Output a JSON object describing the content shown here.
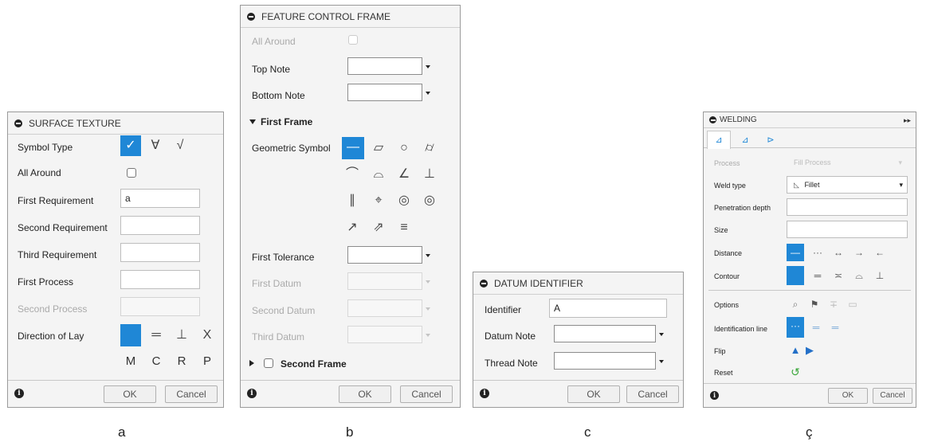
{
  "surface": {
    "title": "SURFACE TEXTURE",
    "symbol_type": "Symbol Type",
    "all_around": "All Around",
    "first_req": "First Requirement",
    "first_req_value": "a",
    "second_req": "Second Requirement",
    "third_req": "Third Requirement",
    "first_process": "First Process",
    "second_process": "Second Process",
    "direction_of_lay": "Direction of Lay",
    "lay_letters": [
      "M",
      "C",
      "R",
      "P"
    ],
    "ok": "OK",
    "cancel": "Cancel"
  },
  "fcf": {
    "title": "FEATURE CONTROL FRAME",
    "all_around": "All Around",
    "top_note": "Top Note",
    "bottom_note": "Bottom Note",
    "first_frame": "First Frame",
    "geometric_symbol": "Geometric Symbol",
    "first_tolerance": "First Tolerance",
    "first_datum": "First Datum",
    "second_datum": "Second Datum",
    "third_datum": "Third Datum",
    "second_frame": "Second Frame",
    "ok": "OK",
    "cancel": "Cancel"
  },
  "datum": {
    "title": "DATUM IDENTIFIER",
    "identifier": "Identifier",
    "identifier_value": "A",
    "datum_note": "Datum Note",
    "thread_note": "Thread Note",
    "ok": "OK",
    "cancel": "Cancel"
  },
  "welding": {
    "title": "WELDING",
    "process": "Process",
    "process_value": "Fill Process",
    "weld_type": "Weld type",
    "weld_type_value": "Fillet",
    "penetration_depth": "Penetration depth",
    "size": "Size",
    "distance": "Distance",
    "contour": "Contour",
    "options": "Options",
    "identification_line": "Identification line",
    "flip": "Flip",
    "reset": "Reset",
    "ok": "OK",
    "cancel": "Cancel"
  },
  "captions": {
    "a": "a",
    "b": "b",
    "c": "c",
    "d": "ç"
  },
  "colors": {
    "accent": "#1f87d6",
    "flip": "#2470c8",
    "reset": "#3aa63a"
  }
}
